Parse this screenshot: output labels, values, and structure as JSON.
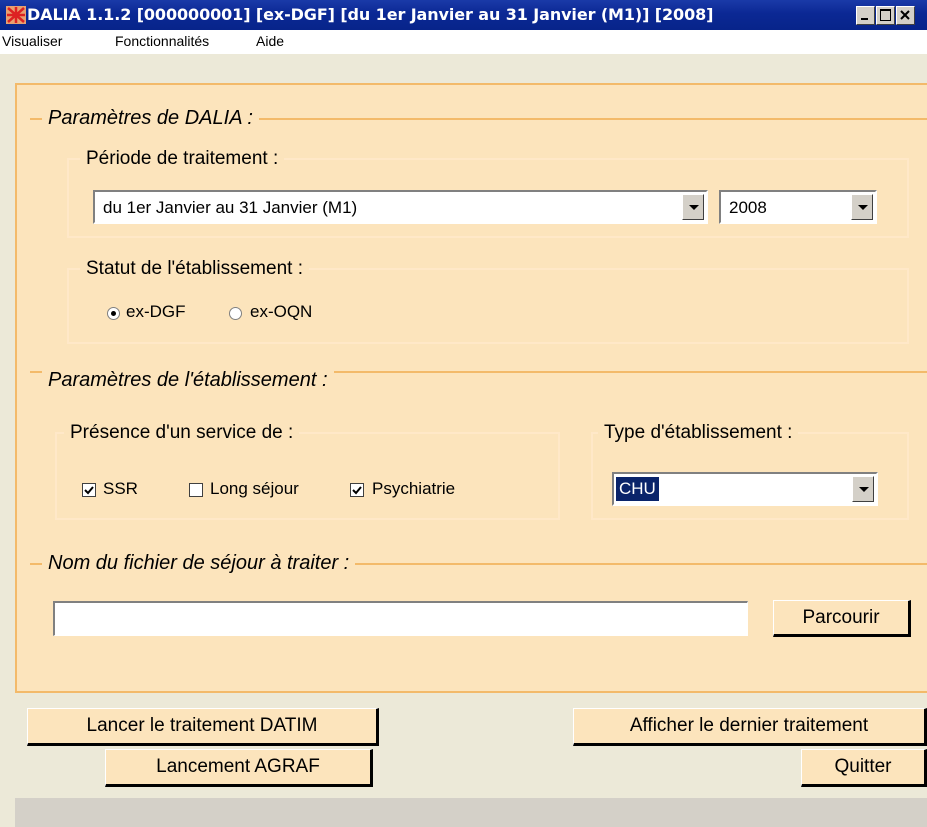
{
  "window": {
    "title": "DALIA 1.1.2  [000000001] [ex-DGF] [du 1er Janvier au 31 Janvier (M1)] [2008]",
    "controls": [
      "minimize",
      "maximize",
      "close"
    ]
  },
  "menu": {
    "items": [
      "Visualiser",
      "Fonctionnalités",
      "Aide"
    ]
  },
  "dalia_params": {
    "title": "Paramètres de DALIA :",
    "periode": {
      "title": "Période de traitement :",
      "selected_period": "du 1er Janvier au 31 Janvier (M1)",
      "selected_year": "2008"
    },
    "statut": {
      "title": "Statut de l'établissement :",
      "options": [
        {
          "label": "ex-DGF",
          "selected": true
        },
        {
          "label": "ex-OQN",
          "selected": false
        }
      ]
    }
  },
  "etab_params": {
    "title": "Paramètres de l'établissement :",
    "services": {
      "title": "Présence d'un service de :",
      "options": [
        {
          "label": "SSR",
          "checked": true
        },
        {
          "label": "Long séjour",
          "checked": false
        },
        {
          "label": "Psychiatrie",
          "checked": true
        }
      ]
    },
    "type": {
      "title": "Type d'établissement :",
      "selected": "CHU"
    }
  },
  "fichier": {
    "title": "Nom du fichier de séjour à traiter :",
    "value": "",
    "browse_label": "Parcourir"
  },
  "actions": {
    "lancer_datim": "Lancer le traitement DATIM",
    "lancement_agraf": "Lancement AGRAF",
    "afficher_dernier": "Afficher le dernier traitement",
    "quitter": "Quitter"
  },
  "colors": {
    "panel_bg": "#fce4bc",
    "title_bar": "#0b2894",
    "selection": "#0a246a"
  }
}
